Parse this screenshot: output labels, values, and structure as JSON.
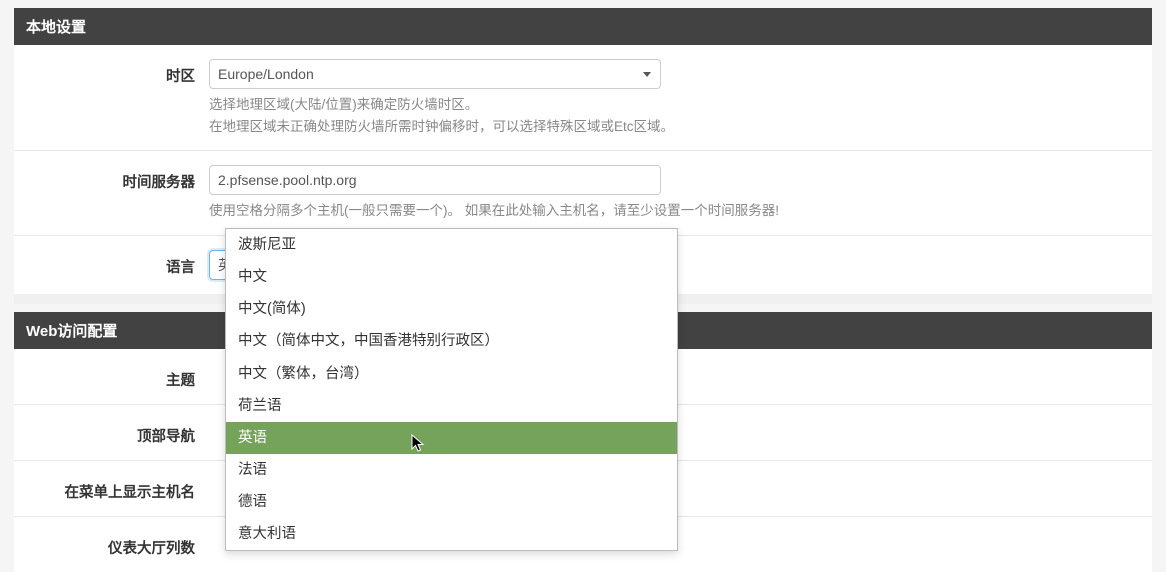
{
  "panels": {
    "local": {
      "title": "本地设置"
    },
    "web": {
      "title": "Web访问配置"
    }
  },
  "timezone": {
    "label": "时区",
    "value": "Europe/London",
    "help1": "选择地理区域(大陆/位置)来确定防火墙时区。",
    "help2": "在地理区域未正确处理防火墙所需时钟偏移时，可以选择特殊区域或Etc区域。"
  },
  "timeservers": {
    "label": "时间服务器",
    "value": "2.pfsense.pool.ntp.org",
    "help": "使用空格分隔多个主机(一般只需要一个)。 如果在此处输入主机名，请至少设置一个时间服务器!"
  },
  "language": {
    "label": "语言",
    "value": "英语",
    "options": [
      "波斯尼亚",
      "中文",
      "中文(简体)",
      "中文（简体中文，中国香港特别行政区）",
      "中文（繁体，台湾）",
      "荷兰语",
      "英语",
      "法语",
      "德语",
      "意大利语"
    ],
    "selected_index": 6
  },
  "theme": {
    "label": "主题"
  },
  "topnav": {
    "label": "顶部导航"
  },
  "hostmenu": {
    "label": "在菜单上显示主机名"
  },
  "dashcols": {
    "label": "仪表大厅列数"
  }
}
